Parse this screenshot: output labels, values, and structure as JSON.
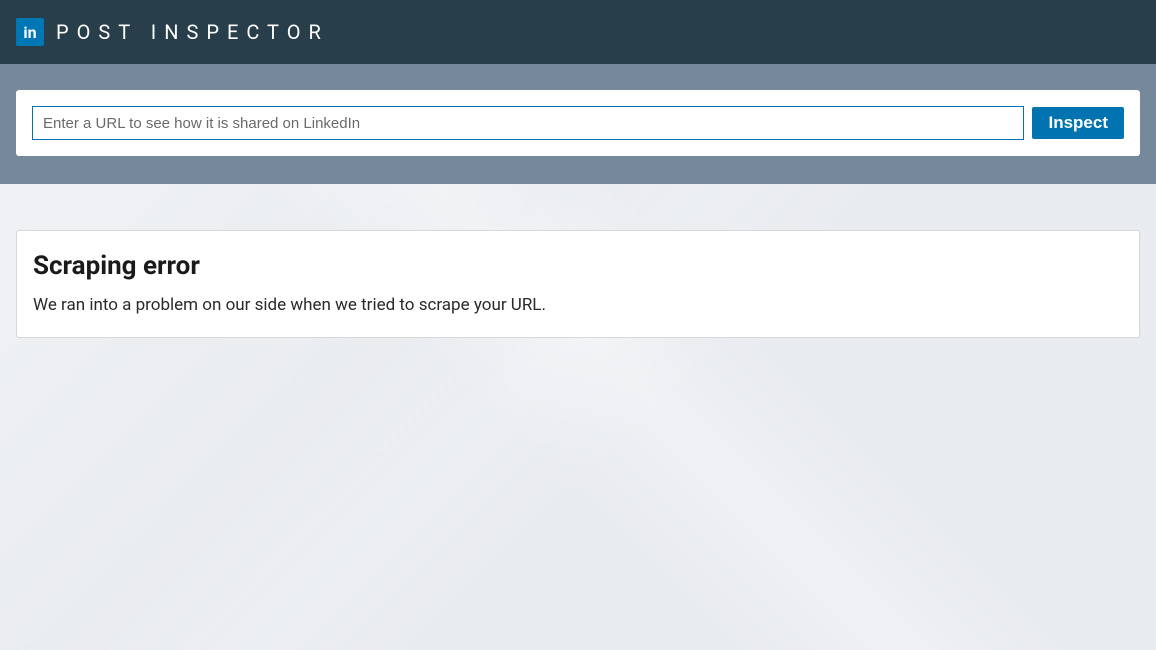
{
  "header": {
    "logo_text": "in",
    "app_title": "POST INSPECTOR"
  },
  "search": {
    "placeholder": "Enter a URL to see how it is shared on LinkedIn",
    "value": "",
    "button_label": "Inspect"
  },
  "error": {
    "title": "Scraping error",
    "message": "We ran into a problem on our side when we tried to scrape your URL."
  }
}
